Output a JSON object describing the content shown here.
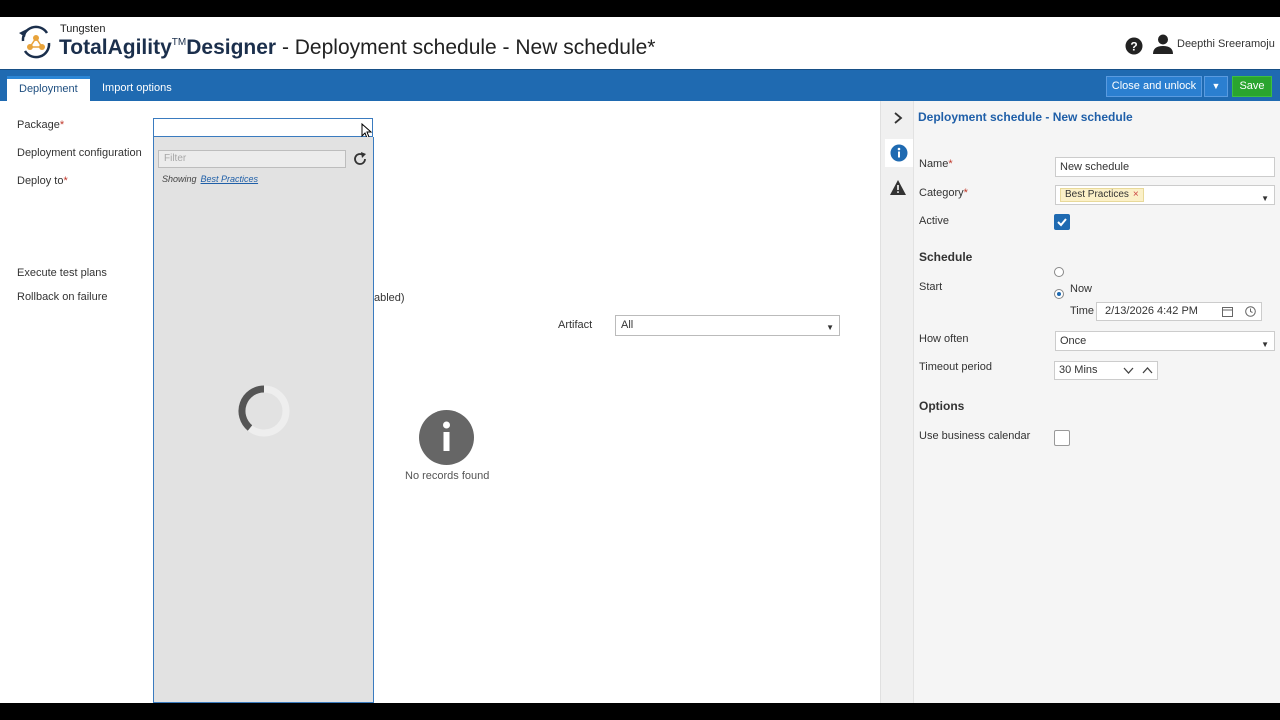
{
  "header": {
    "brand_small": "Tungsten",
    "brand_part1": "TotalAgility",
    "brand_tm": "TM",
    "brand_part2": "Designer",
    "title_rest": " - Deployment schedule - New schedule*",
    "user_name": "Deepthi Sreeramoju",
    "icons": [
      "logo-icon",
      "help-icon",
      "user-icon"
    ]
  },
  "toolbar": {
    "tabs": [
      {
        "label": "Deployment"
      },
      {
        "label": "Import options"
      }
    ],
    "close_label": "Close and unlock",
    "save_label": "Save",
    "colors": {
      "bar": "#1f6ab1",
      "save": "#2aa52f"
    }
  },
  "form": {
    "package_label": "Package",
    "required_mark": "*",
    "deployment_config_label": "Deployment configuration",
    "deploy_to_label": "Deploy to",
    "execute_test_label": "Execute test plans",
    "rollback_label": "Rollback on failure",
    "abled_fragment": "abled)",
    "artifact_label": "Artifact",
    "artifact_value": "All",
    "no_records": "No records found"
  },
  "package_dropdown": {
    "filter_placeholder": "Filter",
    "showing_label": "Showing",
    "showing_link": "Best Practices"
  },
  "right_panel": {
    "title": "Deployment schedule  - New schedule",
    "name_label": "Name",
    "name_value": "New schedule",
    "category_label": "Category",
    "category_chip": "Best Practices",
    "active_label": "Active",
    "active_checked": true,
    "schedule_heading": "Schedule",
    "start_label": "Start",
    "now_label": "Now",
    "time_label": "Time",
    "time_value": "2/13/2026 4:42 PM",
    "how_often_label": "How often",
    "how_often_value": "Once",
    "timeout_label": "Timeout period",
    "timeout_value": "30 Mins",
    "options_heading": "Options",
    "business_calendar_label": "Use business calendar",
    "business_calendar_checked": false
  }
}
